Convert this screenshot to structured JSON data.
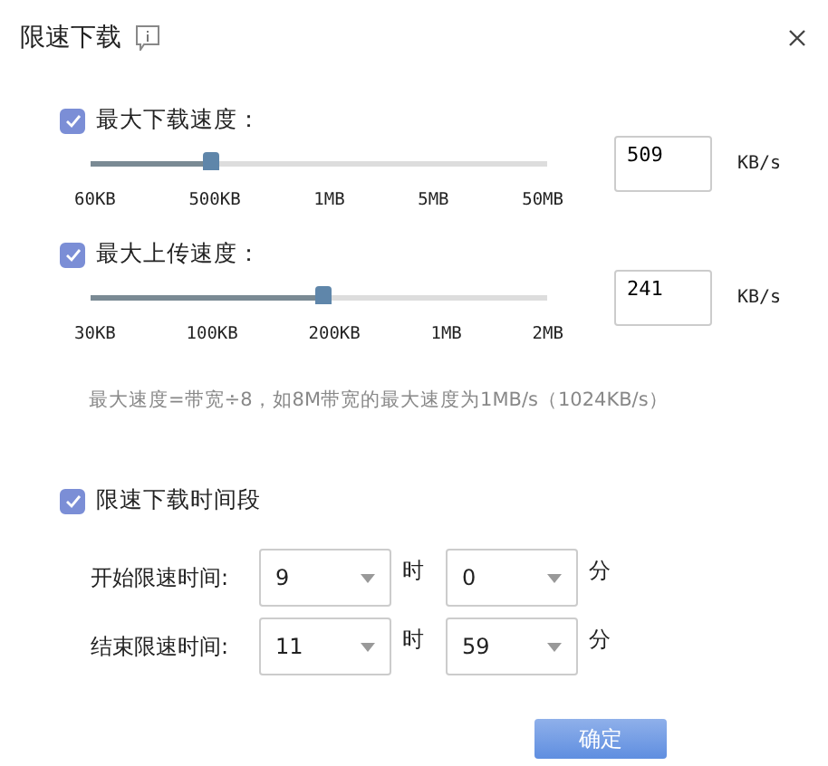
{
  "window": {
    "title": "限速下载"
  },
  "limits": [
    {
      "label": "最大下载速度：",
      "checked": true,
      "level": 0.254,
      "ticks": [
        "60KB",
        "500KB",
        "1MB",
        "5MB",
        "50MB"
      ],
      "value": "509",
      "unit": "KB/s"
    },
    {
      "label": "最大上传速度：",
      "checked": true,
      "level": 0.51,
      "ticks": [
        "30KB",
        "100KB",
        "200KB",
        "1MB",
        "2MB"
      ],
      "value": "241",
      "unit": "KB/s"
    }
  ],
  "note": "最大速度=带宽÷8，如8M带宽的最大速度为1MB/s（1024KB/s）",
  "schedule": {
    "label": "限速下载时间段",
    "checked": true,
    "rows": [
      {
        "label": "开始限速时间:",
        "hour": "9",
        "hour_unit": "时",
        "minute": "0",
        "minute_unit": "分"
      },
      {
        "label": "结束限速时间:",
        "hour": "11",
        "hour_unit": "时",
        "minute": "59",
        "minute_unit": "分"
      }
    ]
  },
  "buttons": [
    {
      "label": "确定"
    }
  ]
}
